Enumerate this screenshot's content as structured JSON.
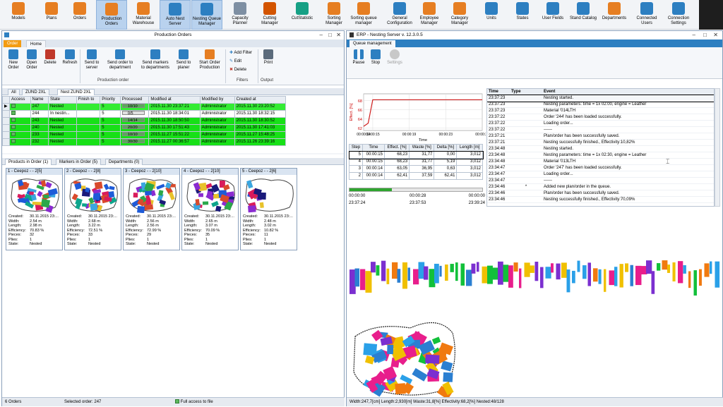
{
  "toolbar": {
    "items": [
      {
        "label1": "Models",
        "label2": "",
        "color": "#e67e22",
        "icon": "cube-icon"
      },
      {
        "label1": "Plans",
        "label2": "",
        "color": "#e67e22",
        "icon": "cube-icon"
      },
      {
        "label1": "Orders",
        "label2": "",
        "color": "#e67e22",
        "icon": "cube-icon"
      },
      {
        "label1": "Production",
        "label2": "Orders",
        "color": "#e67e22",
        "icon": "cube-icon",
        "active": true
      },
      {
        "label1": "Material",
        "label2": "Warehouse",
        "color": "#e67e22",
        "icon": "cube-icon"
      },
      {
        "label1": "Auto Nest",
        "label2": "Server",
        "color": "#2d7fc1",
        "icon": "server-icon",
        "active": true
      },
      {
        "label1": "Nesting Queue",
        "label2": "Manager",
        "color": "#2d7fc1",
        "icon": "queue-icon",
        "active": true
      },
      {
        "label1": "Capacity",
        "label2": "Planner",
        "color": "#7e8fa3",
        "icon": "planner-icon"
      },
      {
        "label1": "Cutting",
        "label2": "Manager",
        "color": "#d35400",
        "icon": "cutting-icon"
      },
      {
        "label1": "CutStatistic",
        "label2": "",
        "color": "#16a085",
        "icon": "statistic-icon"
      },
      {
        "label1": "Sorting",
        "label2": "Manager",
        "color": "#e67e22",
        "icon": "sorting-icon"
      },
      {
        "label1": "Sorting queue",
        "label2": "manager",
        "color": "#e67e22",
        "icon": "sorting-icon"
      },
      {
        "label1": "General",
        "label2": "Configuration",
        "color": "#2d7fc1",
        "icon": "tools-icon"
      },
      {
        "label1": "Employee",
        "label2": "Manager",
        "color": "#e67e22",
        "icon": "employee-icon"
      },
      {
        "label1": "Category",
        "label2": "Manager",
        "color": "#e67e22",
        "icon": "category-icon"
      },
      {
        "label1": "Units",
        "label2": "",
        "color": "#2d7fc1",
        "icon": "units-icon"
      },
      {
        "label1": "States",
        "label2": "",
        "color": "#2d7fc1",
        "icon": "states-icon"
      },
      {
        "label1": "User Fields",
        "label2": "",
        "color": "#2d7fc1",
        "icon": "fields-icon"
      },
      {
        "label1": "Stand Catalog",
        "label2": "",
        "color": "#2d7fc1",
        "icon": "catalog-icon"
      },
      {
        "label1": "Departments",
        "label2": "",
        "color": "#e67e22",
        "icon": "departments-icon"
      },
      {
        "label1": "Connected",
        "label2": "Users",
        "color": "#2d7fc1",
        "icon": "users-icon"
      },
      {
        "label1": "Connection",
        "label2": "Settings",
        "color": "#2d7fc1",
        "icon": "connection-icon"
      }
    ]
  },
  "left_window": {
    "title": "Production Orders",
    "tabs": [
      "Order",
      "Home"
    ],
    "buttons": [
      {
        "l1": "New",
        "l2": "Order",
        "icon": "new-order-icon"
      },
      {
        "l1": "Open",
        "l2": "Order",
        "icon": "open-order-icon"
      },
      {
        "l1": "Delete",
        "l2": "",
        "icon": "delete-icon"
      },
      {
        "l1": "Refresh",
        "l2": "",
        "icon": "refresh-icon"
      },
      {
        "l1": "Send to",
        "l2": "server",
        "icon": "send-server-icon"
      },
      {
        "l1": "Send order to",
        "l2": "department",
        "icon": "send-department-icon"
      },
      {
        "l1": "Send markers",
        "l2": "to departments",
        "icon": "send-markers-icon"
      },
      {
        "l1": "Send to",
        "l2": "planer",
        "icon": "send-planer-icon"
      },
      {
        "l1": "Start Order",
        "l2": "Production",
        "icon": "start-production-icon"
      }
    ],
    "group_production": "Production order",
    "filters": [
      "Add Filter",
      "Edit",
      "Delete"
    ],
    "group_filters": "Filters",
    "print_label": "Print",
    "group_output": "Output",
    "filter_tabs": [
      "All",
      "ZUND 2XL",
      "Nest ZUND 2XL"
    ],
    "columns": [
      "Access",
      "Name",
      "State",
      "Finish to",
      "Priority",
      "Processed",
      "Modified at",
      "Modified by",
      "Created at"
    ],
    "rows": [
      {
        "name": "247",
        "state": "Nested",
        "finish": "",
        "priority": "5",
        "processed": "10/10",
        "pct": 1,
        "modified_at": "2015.11.30 23:37:21",
        "modified_by": "Administrator",
        "created_at": "2015.11.30 23:20:52",
        "green": true,
        "selected": true
      },
      {
        "name": "244",
        "state": "In nestin...",
        "finish": "",
        "priority": "5",
        "processed": "0/5",
        "pct": 0,
        "modified_at": "2015.11.30 18:34:01",
        "modified_by": "Administrator",
        "created_at": "2015.11.30 18:32:15",
        "green": false
      },
      {
        "name": "243",
        "state": "Nested",
        "finish": "",
        "priority": "5",
        "processed": "14/14",
        "pct": 1,
        "modified_at": "2015.11.30 18:50:50",
        "modified_by": "Administrator",
        "created_at": "2015.11.30 18:30:52",
        "green": true
      },
      {
        "name": "240",
        "state": "Nested",
        "finish": "",
        "priority": "5",
        "processed": "20/20",
        "pct": 1,
        "modified_at": "2015.11.30 17:51:43",
        "modified_by": "Administrator",
        "created_at": "2015.11.30 17:41:03",
        "green": true
      },
      {
        "name": "233",
        "state": "Nested",
        "finish": "",
        "priority": "5",
        "processed": "10/10",
        "pct": 1,
        "modified_at": "2015.11.27 15:51:22",
        "modified_by": "Administrator",
        "created_at": "2015.11.27 15:48:25",
        "green": true
      },
      {
        "name": "232",
        "state": "Nested",
        "finish": "",
        "priority": "5",
        "processed": "30/30",
        "pct": 1,
        "modified_at": "2015.11.27 00:36:57",
        "modified_by": "Administrator",
        "created_at": "2015.11.26 23:39:16",
        "green": true
      }
    ],
    "lower_tabs": [
      "Products in Order (1)",
      "Markers in Order (5)",
      "Departments (0)"
    ],
    "card_field_labels": [
      "Created:",
      "Width:",
      "Length:",
      "Efficiency:",
      "Pieces:",
      "Plies:",
      "State:"
    ],
    "cards": [
      {
        "title": "1 - Ceepoz -  - 2[5]",
        "created": "30.11.2015  23:...",
        "width": "2.54 m",
        "length": "2.98 m",
        "efficiency": "70.83 %",
        "pieces": "32",
        "plies": "1",
        "state": "Nested"
      },
      {
        "title": "2 - Ceepoz -  - 2[8]",
        "created": "30.11.2015  23:...",
        "width": "2.68 m",
        "length": "3.22 m",
        "efficiency": "72.51 %",
        "pieces": "33",
        "plies": "1",
        "state": "Nested"
      },
      {
        "title": "3 - Ceepoz -  - 2[10]",
        "created": "30.11.2015  23:...",
        "width": "2.56 m",
        "length": "2.56 m",
        "efficiency": "72.99 %",
        "pieces": "29",
        "plies": "1",
        "state": "Nested"
      },
      {
        "title": "4 - Ceepoz -  - 2[10]",
        "created": "30.11.2015  23:...",
        "width": "2.65 m",
        "length": "3.07 m",
        "efficiency": "70.09 %",
        "pieces": "35",
        "plies": "1",
        "state": "Nested"
      },
      {
        "title": "5 - Ceepoz -  - 2[6]",
        "created": "30.11.2015  23:...",
        "width": "2.48 m",
        "length": "3.02 m",
        "efficiency": "10.82 %",
        "pieces": "11",
        "plies": "1",
        "state": "Nested"
      }
    ],
    "status": {
      "orders": "6 Orders",
      "selected": "Selected order:  247",
      "access": "Full access to file"
    }
  },
  "right_window": {
    "title": "ERP - Nesting Server v. 12.3.0.5",
    "tab": "Queue management",
    "buttons": [
      "Pause",
      "Stop",
      "Settings"
    ],
    "event_columns": [
      "Time",
      "Type",
      "Event"
    ],
    "events": [
      {
        "time": "23:37:23",
        "type": "",
        "event": "Nesting started.",
        "selected": true
      },
      {
        "time": "23:37:23",
        "type": "",
        "event": "Nesting parameters: time = 1x 02:00, engine = Leather"
      },
      {
        "time": "23:37:23",
        "type": "",
        "event": "Material '014LTH"
      },
      {
        "time": "23:37:22",
        "type": "",
        "event": "Order '244' has been loaded successfully."
      },
      {
        "time": "23:37:22",
        "type": "",
        "event": "Loading order..."
      },
      {
        "time": "23:37:22",
        "type": "",
        "event": "------"
      },
      {
        "time": "23:37:21",
        "type": "",
        "event": "Plan/order has been successfully saved."
      },
      {
        "time": "23:37:21",
        "type": "",
        "event": "Nesting successfully finished., Effectivity:10,82%"
      },
      {
        "time": "23:34:48",
        "type": "",
        "event": "Nesting started."
      },
      {
        "time": "23:34:48",
        "type": "",
        "event": "Nesting parameters: time = 1x 02:30, engine = Leather"
      },
      {
        "time": "23:34:48",
        "type": "",
        "event": "Material '013LTH"
      },
      {
        "time": "23:34:47",
        "type": "",
        "event": "Order '247' has been loaded successfully."
      },
      {
        "time": "23:34:47",
        "type": "",
        "event": "Loading order..."
      },
      {
        "time": "23:34:47",
        "type": "",
        "event": "------"
      },
      {
        "time": "23:34:46",
        "type": "*",
        "event": "Added new plan/order in the queue."
      },
      {
        "time": "23:34:46",
        "type": "",
        "event": "Plan/order has been successfully saved."
      },
      {
        "time": "23:34:46",
        "type": "",
        "event": "Nesting successfully finished., Effectivity:70,09%"
      }
    ],
    "step_columns": [
      "Step",
      "Time",
      "Effect. [%]",
      "Waste [%]",
      "Delta [%]",
      "Length [m]"
    ],
    "steps": [
      {
        "step": "5",
        "time": "00:00:15",
        "eff": "68,23",
        "waste": "31,77",
        "delta": "0,00",
        "length": "3,012",
        "selected": true
      },
      {
        "step": "4",
        "time": "00:00:15",
        "eff": "68,23",
        "waste": "31,77",
        "delta": "5,19",
        "length": "3,012"
      },
      {
        "step": "3",
        "time": "00:00:14",
        "eff": "63,05",
        "waste": "36,95",
        "delta": "0,63",
        "length": "3,012"
      },
      {
        "step": "2",
        "time": "00:00:14",
        "eff": "62,41",
        "waste": "37,59",
        "delta": "62,41",
        "length": "3,012"
      }
    ],
    "progress": {
      "value": 0.32,
      "elapsed": "00:00:00",
      "mid": "00:00:28",
      "total": "00:00:00",
      "start": "23:37:24",
      "mid_t": "23:37:53",
      "end": "23:39:24"
    },
    "status": "Width:247,7[cm]  Length:2,930[m]  Waste:31,8[%]  Effectivity:68,2[%]  Nested:48/128"
  },
  "chart_data": {
    "type": "line",
    "title": "",
    "xlabel": "Time",
    "ylabel": "Effect. [%]",
    "x": [
      "00:00:14",
      "00:00:15",
      "00:00:15",
      "00:00:19",
      "00:00:23",
      "00:00:27"
    ],
    "x_seconds": [
      14.0,
      14.5,
      15.0,
      19.0,
      23.0,
      27.0
    ],
    "values": [
      62.4,
      63.1,
      68.2,
      68.2,
      68.2,
      68.2
    ],
    "xticks": [
      "00:00:14",
      "00:00:15",
      "00:00:19",
      "00:00:23",
      "00:00:27"
    ],
    "yticks": [
      62,
      64,
      66,
      68
    ],
    "ylim": [
      61.5,
      69.5
    ],
    "color": "#d02020",
    "grid": true
  }
}
